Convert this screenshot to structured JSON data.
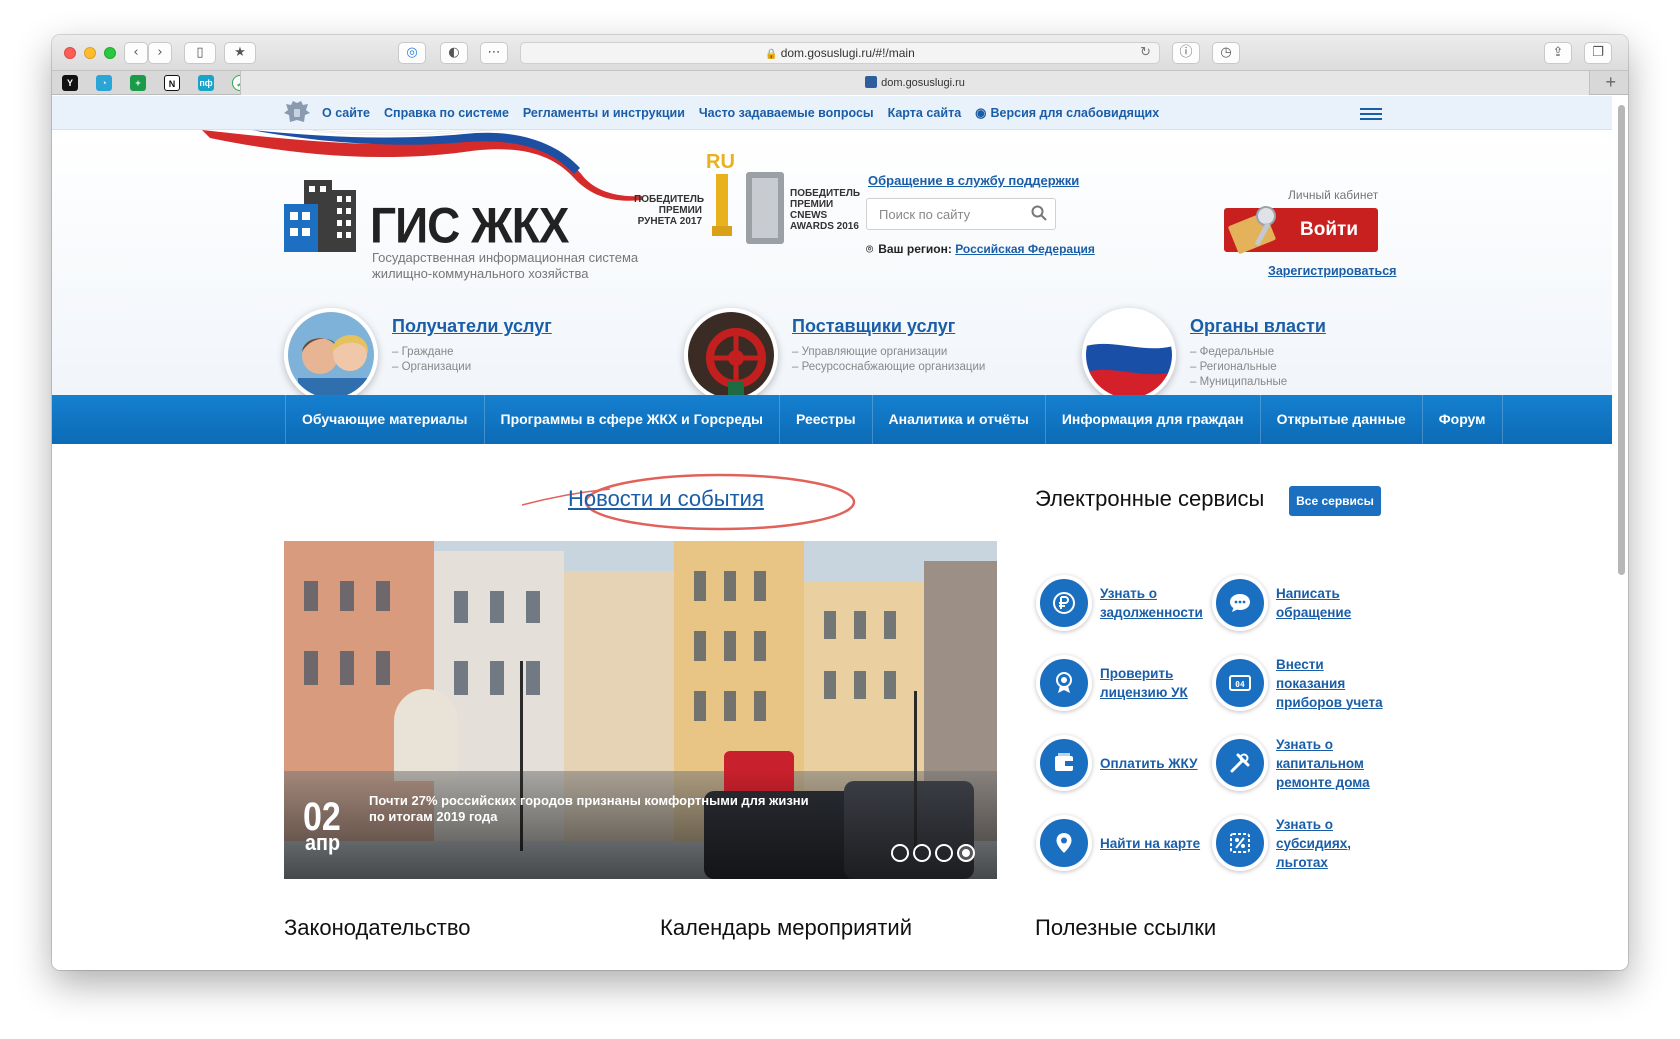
{
  "browser": {
    "url": "dom.gosuslugi.ru/#!/main",
    "tab_title": "dom.gosuslugi.ru",
    "back_icon": "chevron-left-icon",
    "forward_icon": "chevron-right-icon"
  },
  "topbar": {
    "links": [
      "О сайте",
      "Справка по системе",
      "Регламенты и инструкции",
      "Часто задаваемые вопросы",
      "Карта сайта"
    ],
    "accessibility_link": "Версия для слабовидящих"
  },
  "header": {
    "logo_title": "ГИС ЖКХ",
    "logo_subtitle_line1": "Государственная информационная система",
    "logo_subtitle_line2": "жилищно-коммунального хозяйства",
    "award1_text": "ПОБЕДИТЕЛЬ\nПРЕМИИ\nРУНЕТА 2017",
    "award2_text": "ПОБЕДИТЕЛЬ\nПРЕМИИ\nCNEWS\nAWARDS 2016",
    "support_link": "Обращение в службу поддержки",
    "search_placeholder": "Поиск по сайту",
    "region_label": "Ваш регион:",
    "region_value": "Российская Федерация",
    "cabinet_label": "Личный кабинет",
    "login_label": "Войти",
    "register_link": "Зарегистрироваться"
  },
  "categories": [
    {
      "title": "Получатели услуг",
      "items": [
        "– Граждане",
        "– Организации"
      ]
    },
    {
      "title": "Поставщики услуг",
      "items": [
        "– Управляющие организации",
        "– Ресурсоснабжающие организации"
      ]
    },
    {
      "title": "Органы власти",
      "items": [
        "– Федеральные",
        "– Региональные",
        "– Муниципальные"
      ]
    }
  ],
  "nav": [
    "Обучающие материалы",
    "Программы в сфере ЖКХ и Горсреды",
    "Реестры",
    "Аналитика и отчёты",
    "Информация для граждан",
    "Открытые данные",
    "Форум"
  ],
  "news": {
    "section_title": "Новости и события",
    "day": "02",
    "month": "апр",
    "caption": "Почти 27% российских городов признаны комфортными для жизни по итогам 2019 года",
    "slides_total": 4,
    "active_slide": 4
  },
  "services": {
    "title": "Электронные сервисы",
    "all_button": "Все сервисы",
    "items": [
      {
        "icon": "ruble-icon",
        "lines": [
          "Узнать о",
          "задолженности"
        ]
      },
      {
        "icon": "chat-icon",
        "lines": [
          "Написать",
          "обращение"
        ]
      },
      {
        "icon": "license-icon",
        "lines": [
          "Проверить",
          "лицензию УК"
        ]
      },
      {
        "icon": "meter-icon",
        "lines": [
          "Внести",
          "показания",
          "приборов учета"
        ]
      },
      {
        "icon": "wallet-icon",
        "lines": [
          "Оплатить ЖКУ"
        ]
      },
      {
        "icon": "tools-icon",
        "lines": [
          "Узнать о",
          "капитальном",
          "ремонте дома"
        ]
      },
      {
        "icon": "map-pin-icon",
        "lines": [
          "Найти на карте"
        ]
      },
      {
        "icon": "percent-icon",
        "lines": [
          "Узнать о",
          "субсидиях,",
          "льготах"
        ]
      }
    ]
  },
  "bottom_sections": [
    "Законодательство",
    "Календарь мероприятий",
    "Полезные ссылки"
  ]
}
